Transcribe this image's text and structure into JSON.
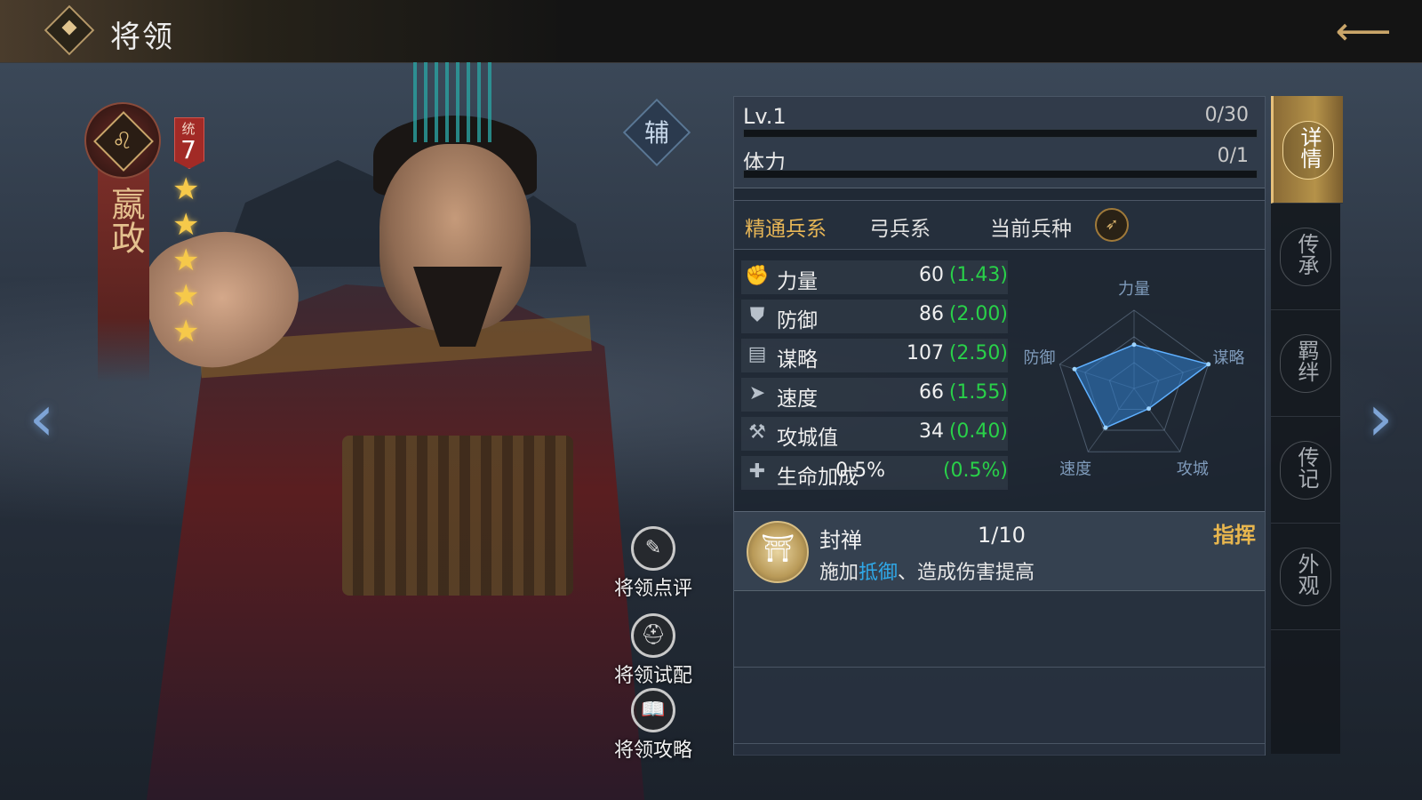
{
  "header": {
    "title": "将领"
  },
  "general": {
    "name": "嬴政",
    "command_label": "统",
    "command_value": "7",
    "stars": 5,
    "role_badge": "辅"
  },
  "level": {
    "label": "Lv.1",
    "value": "0/30",
    "progress": 0
  },
  "stamina": {
    "label": "体力",
    "value": "0/1",
    "progress": 0
  },
  "troop": {
    "mastery_label": "精通兵系",
    "mastery_value": "弓兵系",
    "current_label": "当前兵种",
    "current_icon": "bow-icon"
  },
  "stats": [
    {
      "name": "力量",
      "value": "60",
      "growth": "(1.43)",
      "icon": "fist-icon"
    },
    {
      "name": "防御",
      "value": "86",
      "growth": "(2.00)",
      "icon": "shield-icon"
    },
    {
      "name": "谋略",
      "value": "107",
      "growth": "(2.50)",
      "icon": "book-icon"
    },
    {
      "name": "速度",
      "value": "66",
      "growth": "(1.55)",
      "icon": "boot-icon"
    },
    {
      "name": "攻城值",
      "value": "34",
      "growth": "(0.40)",
      "icon": "hammer-icon"
    },
    {
      "name": "生命加成",
      "value": "0.5%",
      "growth": "(0.5%)",
      "icon": "heart-icon"
    }
  ],
  "radar": {
    "labels": [
      "力量",
      "谋略",
      "攻城",
      "速度",
      "防御"
    ],
    "values": [
      0.56,
      1.0,
      0.32,
      0.62,
      0.8
    ]
  },
  "skill": {
    "name": "封禅",
    "level": "1/10",
    "type": "指挥",
    "desc_prefix": "施加",
    "desc_highlight": "抵御",
    "desc_suffix": "、造成伤害提高"
  },
  "actions": [
    {
      "label": "将领点评",
      "icon": "review-icon"
    },
    {
      "label": "将领试配",
      "icon": "helmet-icon"
    },
    {
      "label": "将领攻略",
      "icon": "guide-book-icon"
    }
  ],
  "tabs": [
    {
      "label": "详情",
      "active": true
    },
    {
      "label": "传承",
      "active": false
    },
    {
      "label": "羁绊",
      "active": false
    },
    {
      "label": "传记",
      "active": false
    },
    {
      "label": "外观",
      "active": false
    }
  ],
  "colors": {
    "accent_gold": "#c9a56a",
    "growth_green": "#29d149",
    "highlight_blue": "#2fa8e8",
    "label_orange": "#e7b656"
  }
}
